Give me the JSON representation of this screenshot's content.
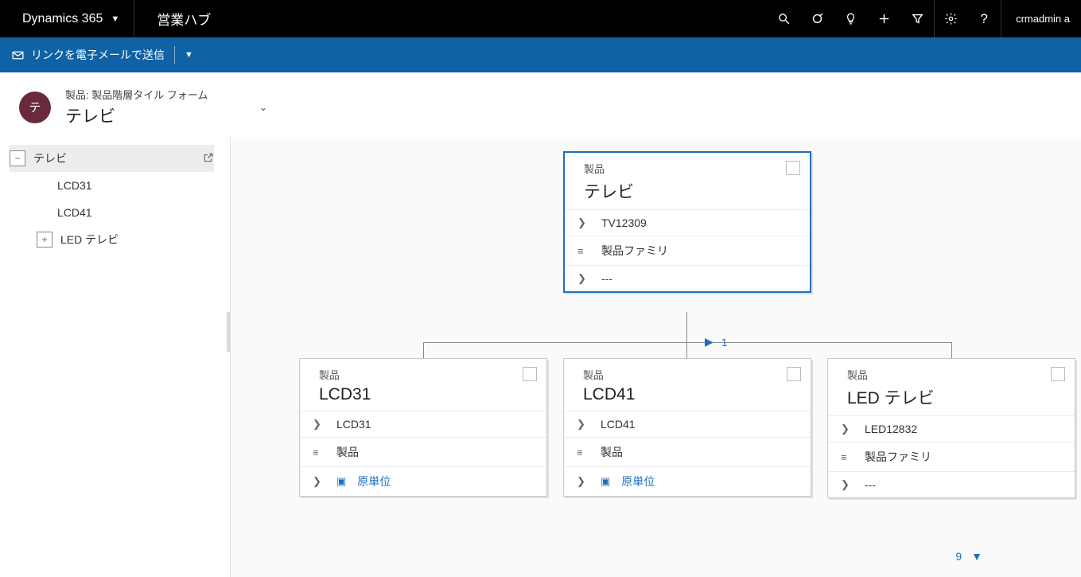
{
  "top": {
    "brand": "Dynamics 365",
    "app": "営業ハブ",
    "user": "crmadmin a"
  },
  "cmdbar": {
    "email_link": "リンクを電子メールで送信"
  },
  "header": {
    "avatar_letter": "テ",
    "breadcrumb": "製品: 製品階層タイル フォーム",
    "title": "テレビ"
  },
  "tree": {
    "root": "テレビ",
    "children": [
      {
        "label": "LCD31",
        "expandable": false
      },
      {
        "label": "LCD41",
        "expandable": false
      },
      {
        "label": "LED テレビ",
        "expandable": true
      }
    ]
  },
  "hierarchy": {
    "label": "製品",
    "tag_icon_name": "tag-icon",
    "list_icon_name": "list-icon",
    "unit_icon_name": "unit-icon",
    "parent": {
      "title": "テレビ",
      "id": "TV12309",
      "type": "製品ファミリ",
      "unit": "---"
    },
    "children": [
      {
        "title": "LCD31",
        "id": "LCD31",
        "type": "製品",
        "unit": "原単位",
        "has_unit_link": true
      },
      {
        "title": "LCD41",
        "id": "LCD41",
        "type": "製品",
        "unit": "原単位",
        "has_unit_link": true
      },
      {
        "title": "LED テレビ",
        "id": "LED12832",
        "type": "製品ファミリ",
        "unit": "---",
        "has_unit_link": false
      }
    ]
  },
  "pager": {
    "current": "1",
    "total_footer": "9"
  }
}
